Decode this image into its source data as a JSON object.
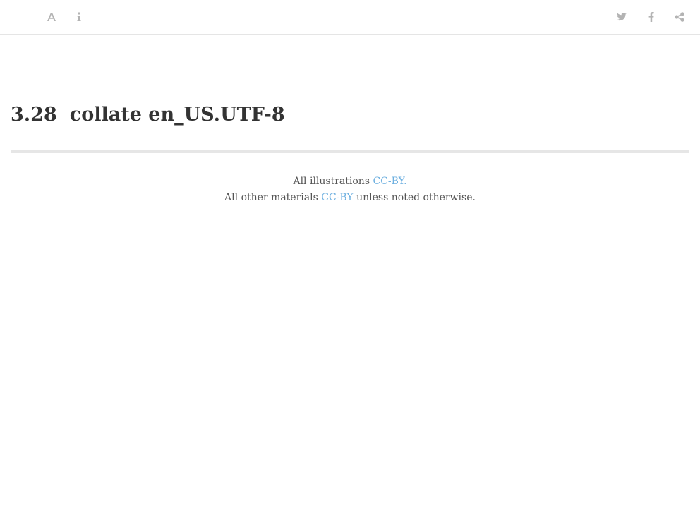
{
  "toolbar": {
    "left_icons": [
      "font-icon",
      "info-icon"
    ],
    "right_icons": [
      "twitter-icon",
      "facebook-icon",
      "share-icon"
    ],
    "icon_color": "#b3b3b3"
  },
  "page": {
    "section_number": "3.28",
    "section_title": "collate en_US.UTF-8"
  },
  "footer": {
    "line1_prefix": "All illustrations ",
    "line1_link": "CC-BY.",
    "line2_prefix": "All other materials ",
    "line2_link": "CC-BY",
    "line2_suffix": " unless noted otherwise.",
    "link_color": "#6eb0e0"
  }
}
